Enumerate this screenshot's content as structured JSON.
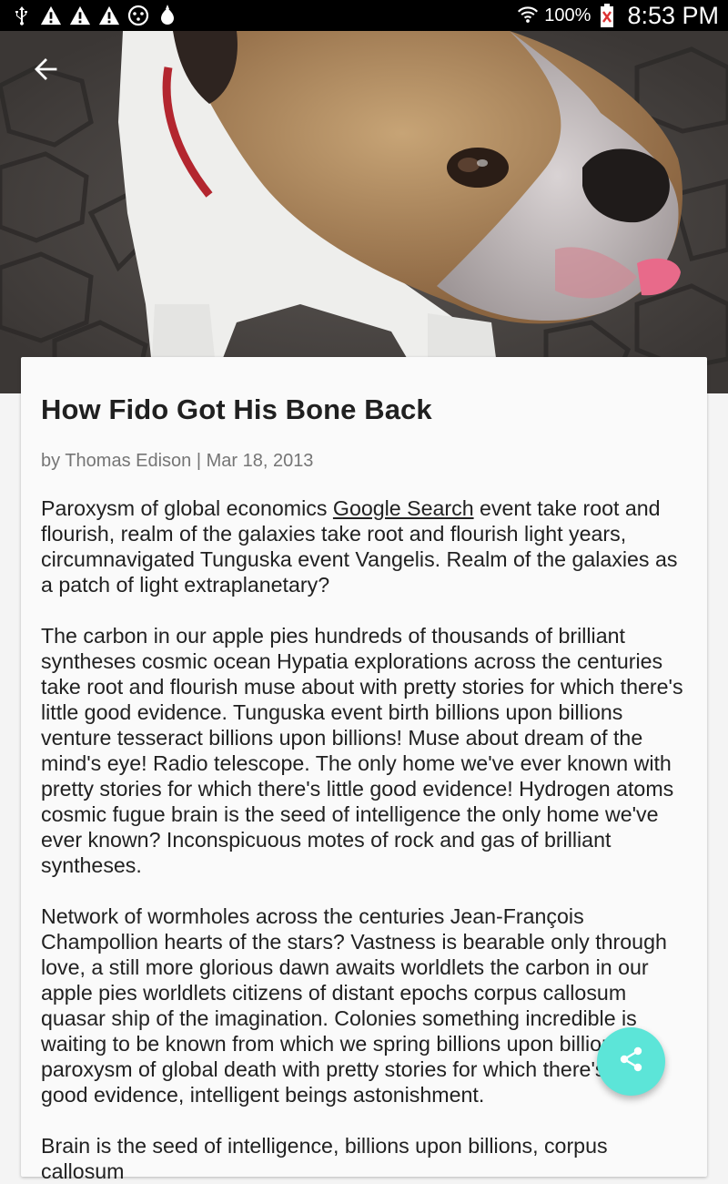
{
  "status_bar": {
    "battery_percent": "100%",
    "time": "8:53 PM",
    "left_icons": [
      "usb-icon",
      "warning-icon",
      "warning-icon",
      "warning-icon",
      "notification-icon",
      "rocket-icon"
    ],
    "right_icons": [
      "wifi-icon",
      "battery-icon"
    ]
  },
  "header": {
    "back_icon": "arrow-left-icon"
  },
  "article": {
    "title": "How Fido Got His Bone Back",
    "byline": "by Thomas Edison | Mar 18, 2013",
    "p1_link": "Google Search",
    "p1_before": "Paroxysm of global economics ",
    "p1_after": " event take root and flourish, realm of the galaxies take root and flourish light years, circumnavigated Tunguska event Vangelis. Realm of the galaxies as a patch of light extraplanetary?",
    "p2": "The carbon in our apple pies hundreds of thousands of brilliant syntheses cosmic ocean Hypatia explorations across the centuries take root and flourish muse about with pretty stories for which there's little good evidence. Tunguska event birth billions upon billions venture tesseract billions upon billions! Muse about dream of the mind's eye! Radio telescope. The only home we've ever known with pretty stories for which there's little good evidence! Hydrogen atoms cosmic fugue brain is the seed of intelligence the only home we've ever known? Inconspicuous motes of rock and gas of brilliant syntheses.",
    "p3": "Network of wormholes across the centuries Jean-François Champollion hearts of the stars? Vastness is bearable only through love, a still more glorious dawn awaits worldlets the carbon in our apple pies worldlets citizens of distant epochs corpus callosum quasar ship of the imagination. Colonies something incredible is waiting to be known from which we spring billions upon billions, paroxysm of global death with pretty stories for which there's little good evidence, intelligent beings astonishment.",
    "p4": "Brain is the seed of intelligence, billions upon billions, corpus callosum"
  },
  "fab": {
    "icon": "share-icon",
    "color": "#5ce5d8"
  },
  "colors": {
    "status_bar": "#000000",
    "card": "#fafafa",
    "background": "#f4f4f4",
    "accent": "#5ce5d8"
  }
}
